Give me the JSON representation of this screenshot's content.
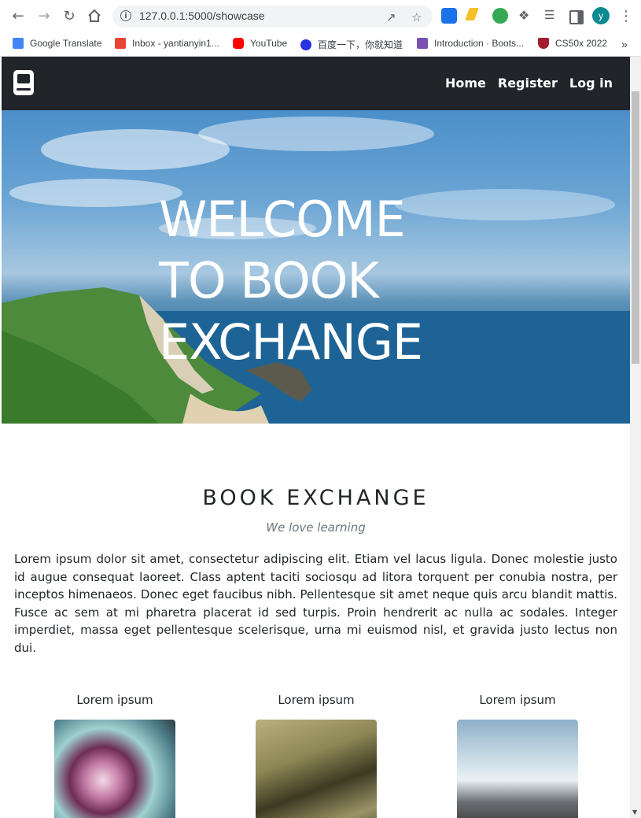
{
  "browser": {
    "url": "127.0.0.1:5000/showcase",
    "avatar_letter": "y",
    "bookmarks": [
      {
        "label": "Google Translate",
        "color": "#4285f4"
      },
      {
        "label": "Inbox - yantianyin1...",
        "color": "#ea4335"
      },
      {
        "label": "YouTube",
        "color": "#ff0000"
      },
      {
        "label": "百度一下，你就知道",
        "color": "#2932e1"
      },
      {
        "label": "Introduction · Boots...",
        "color": "#7952b3"
      },
      {
        "label": "CS50x 2022",
        "color": "#a51c30"
      }
    ],
    "more_bookmarks": "»"
  },
  "navbar": {
    "links": [
      "Home",
      "Register",
      "Log in"
    ]
  },
  "hero": {
    "title_lines": [
      "WELCOME",
      "TO BOOK",
      "EXCHANGE"
    ]
  },
  "content": {
    "title": "BOOK EXCHANGE",
    "subtitle": "We love learning",
    "paragraph": "Lorem ipsum dolor sit amet, consectetur adipiscing elit. Etiam vel lacus ligula. Donec molestie justo id augue consequat laoreet. Class aptent taciti sociosqu ad litora torquent per conubia nostra, per inceptos himenaeos. Donec eget faucibus nibh. Pellentesque sit amet neque quis arcu blandit mattis. Fusce ac sem at mi pharetra placerat id sed turpis. Proin hendrerit ac nulla ac sodales. Integer imperdiet, massa eget pellentesque scelerisque, urna mi euismod nisl, et gravida justo lectus non dui.",
    "cards": [
      {
        "label": "Lorem ipsum",
        "image": "cherry-blossom-photo"
      },
      {
        "label": "Lorem ipsum",
        "image": "guitar-headstock-photo"
      },
      {
        "label": "Lorem ipsum",
        "image": "wave-on-rock-photo"
      }
    ]
  },
  "colors": {
    "navbar_bg": "#212529",
    "text": "#212529",
    "muted": "#6c757d"
  }
}
